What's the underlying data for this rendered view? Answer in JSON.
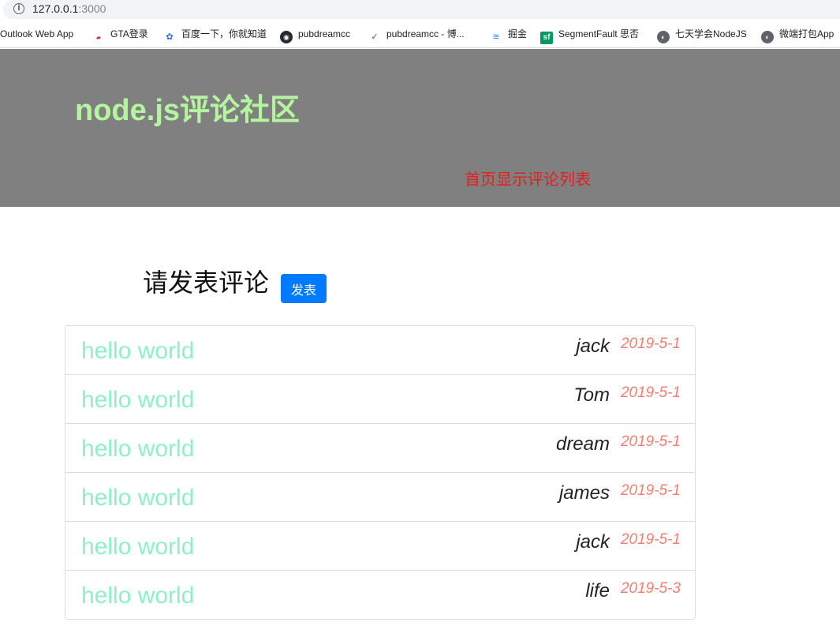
{
  "browser": {
    "url_host": "127.0.0.1",
    "url_port": ":3000",
    "bookmarks": [
      {
        "label": "Outlook Web App",
        "icon": "outlook-icon"
      },
      {
        "label": "GTA登录",
        "icon": "gta-icon"
      },
      {
        "label": "百度一下，你就知道",
        "icon": "baidu-paw-icon"
      },
      {
        "label": "pubdreamcc",
        "icon": "github-icon"
      },
      {
        "label": "pubdreamcc - 博...",
        "icon": "cnblogs-icon"
      },
      {
        "label": "掘金",
        "icon": "juejin-icon"
      },
      {
        "label": "SegmentFault 思否",
        "icon": "segmentfault-icon"
      },
      {
        "label": "七天学会NodeJS",
        "icon": "globe-icon"
      },
      {
        "label": "微端打包App",
        "icon": "globe-icon"
      }
    ]
  },
  "header": {
    "title": "node.js评论社区",
    "nav_link": "首页显示评论列表",
    "title_color": "#b5f5a0",
    "background": "#808080",
    "nav_color": "#e02020"
  },
  "compose": {
    "prompt": "请发表评论",
    "button_label": "发表",
    "button_color": "#007bff"
  },
  "comments": [
    {
      "text": "hello world",
      "author": "jack",
      "date": "2019-5-1"
    },
    {
      "text": "hello world",
      "author": "Tom",
      "date": "2019-5-1"
    },
    {
      "text": "hello world",
      "author": "dream",
      "date": "2019-5-1"
    },
    {
      "text": "hello world",
      "author": "james",
      "date": "2019-5-1"
    },
    {
      "text": "hello world",
      "author": "jack",
      "date": "2019-5-1"
    },
    {
      "text": "hello world",
      "author": "life",
      "date": "2019-5-3"
    }
  ]
}
